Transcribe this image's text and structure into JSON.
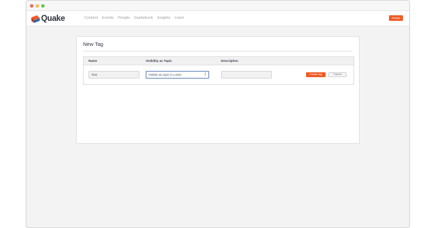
{
  "app": {
    "name": "Quake",
    "brand_color": "#f15a24"
  },
  "nav": {
    "items": [
      {
        "label": "Content"
      },
      {
        "label": "Events"
      },
      {
        "label": "People"
      },
      {
        "label": "Gradebook"
      },
      {
        "label": "Insights"
      },
      {
        "label": "Learn"
      }
    ],
    "assign_label": "Assign"
  },
  "form": {
    "title": "New Tag",
    "columns": {
      "name": "Name",
      "visibility": "Visibility as Topic",
      "description": "Description"
    },
    "name_value": "Test",
    "visibility_value": "Visible as topic in Learn",
    "description_value": "",
    "create_label": "Create tag",
    "cancel_label": "Cancel"
  },
  "icons": {
    "logo": "quake-logo-icon",
    "select_arrows": "up-down-arrows-icon"
  }
}
